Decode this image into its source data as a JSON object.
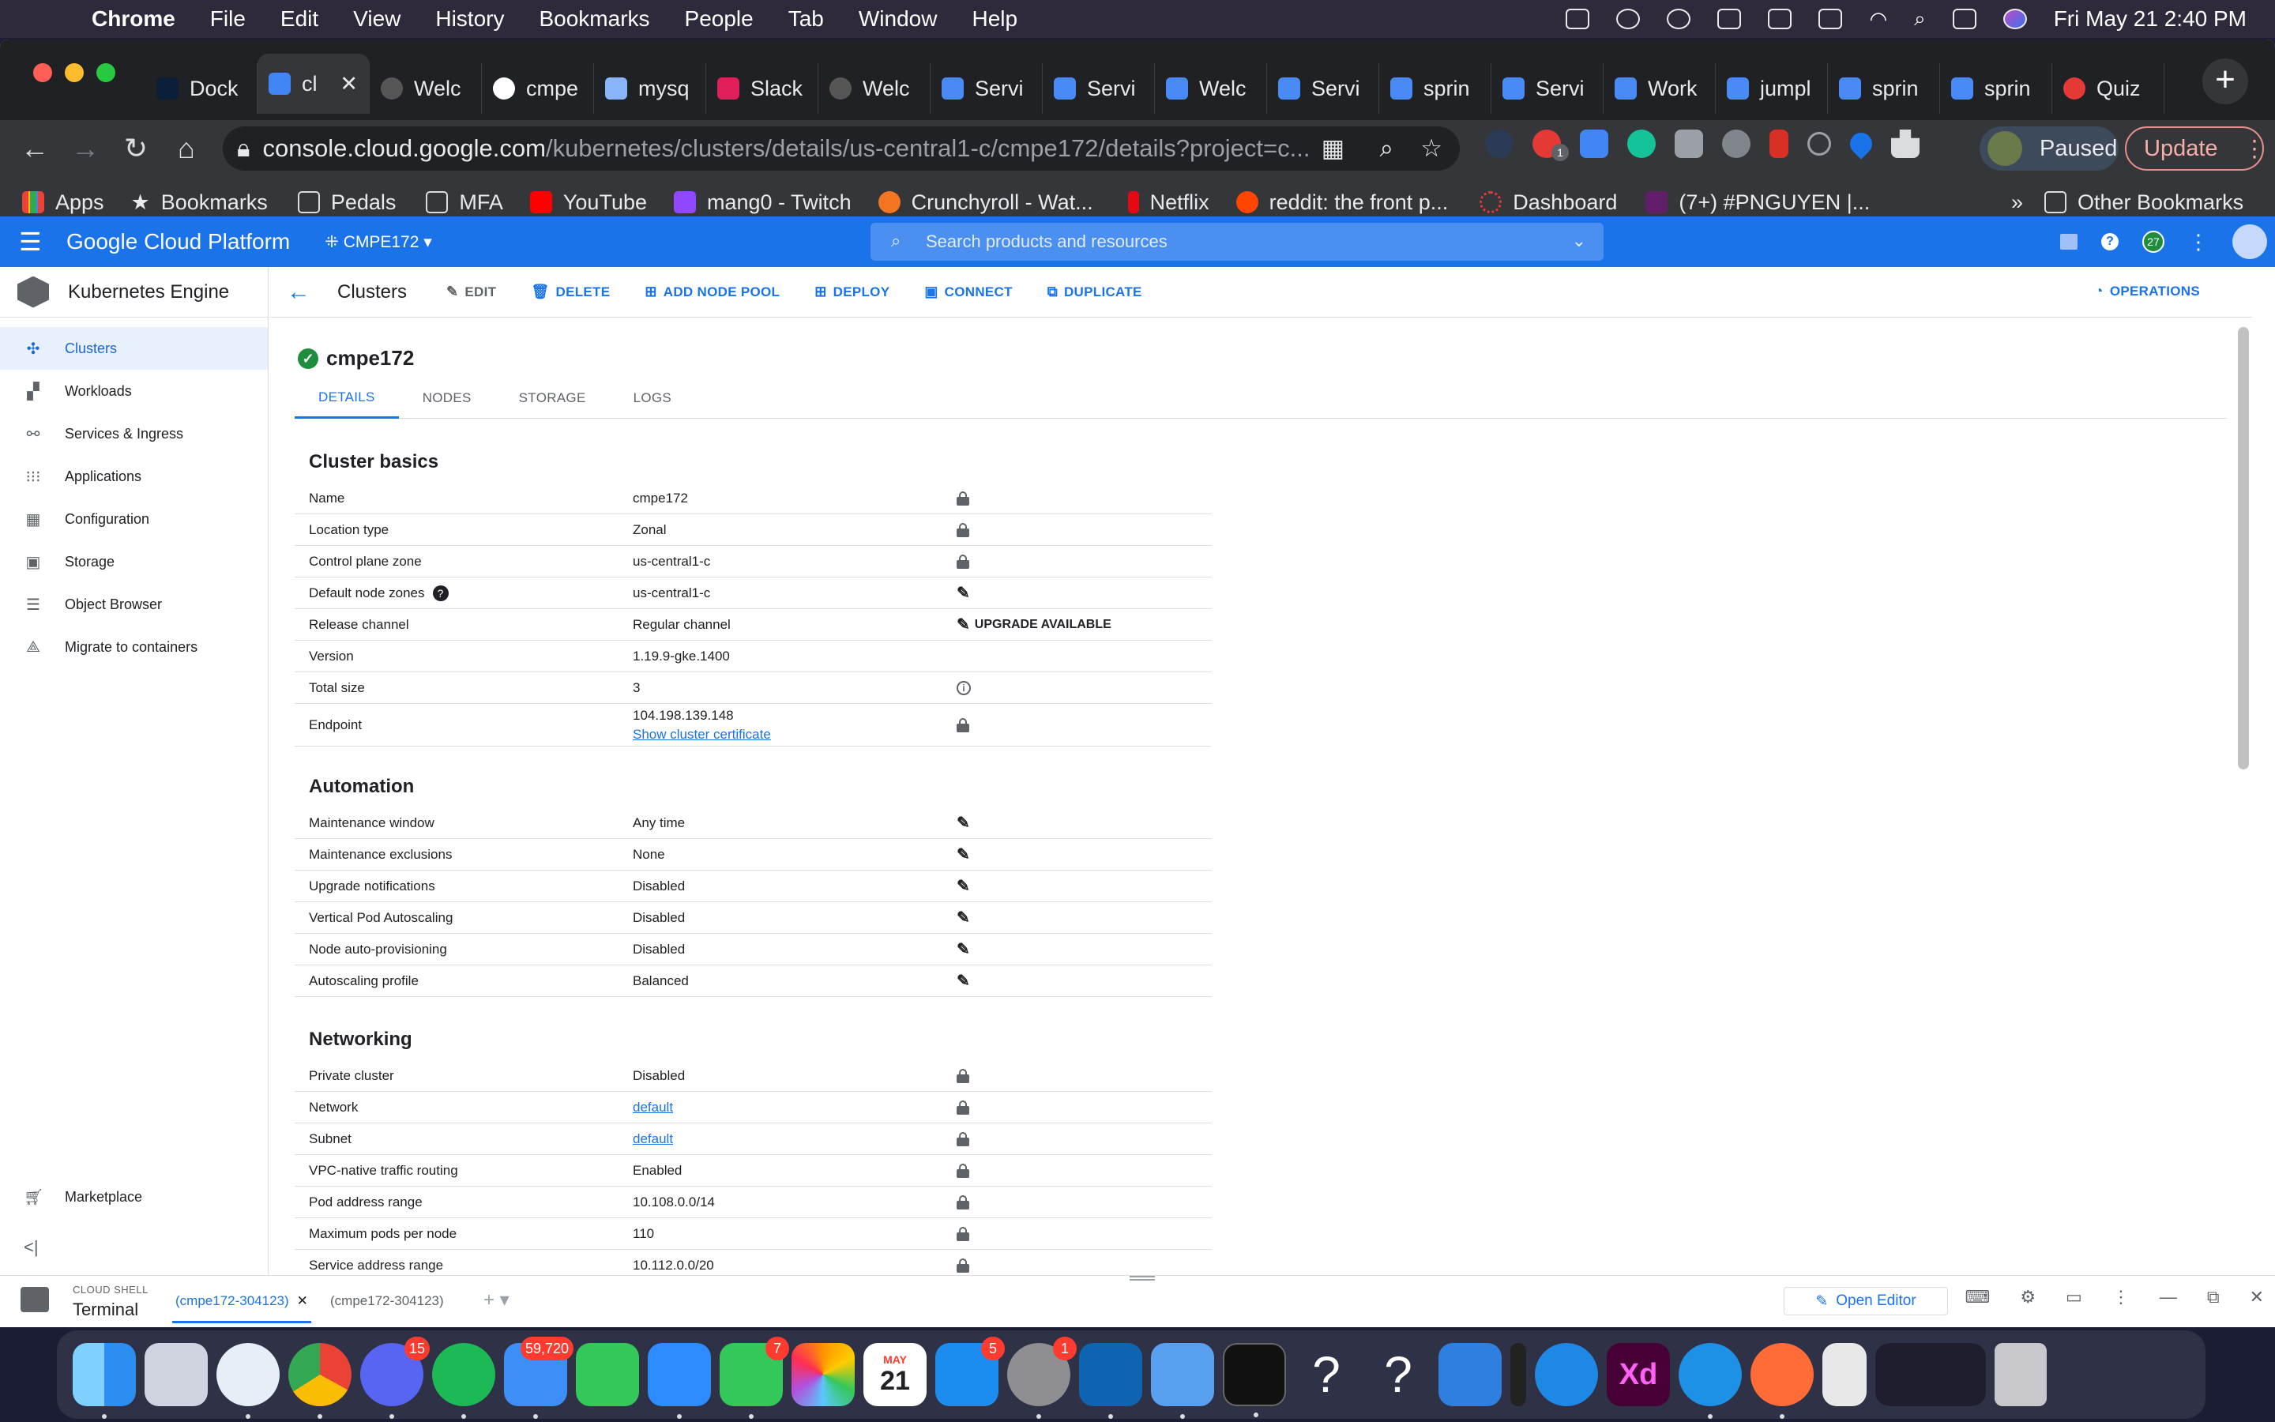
{
  "menubar": {
    "app": "Chrome",
    "items": [
      "File",
      "Edit",
      "View",
      "History",
      "Bookmarks",
      "People",
      "Tab",
      "Window",
      "Help"
    ],
    "datetime": "Fri May 21  2:40 PM"
  },
  "browser": {
    "tabs": [
      "Dock",
      "cl",
      "Welc",
      "cmpe",
      "mysq",
      "Slack",
      "Welc",
      "Servi",
      "Servi",
      "Welc",
      "Servi",
      "sprin",
      "Servi",
      "Work",
      "jumpl",
      "sprin",
      "sprin",
      "Quiz"
    ],
    "url_host": "console.cloud.google.com",
    "url_path": "/kubernetes/clusters/details/us-central1-c/cmpe172/details?project=c...",
    "profile_label": "Paused",
    "update_label": "Update",
    "bookmarks": [
      "Apps",
      "Bookmarks",
      "Pedals",
      "MFA",
      "YouTube",
      "mang0 - Twitch",
      "Crunchyroll - Wat...",
      "Netflix",
      "reddit: the front p...",
      "Dashboard",
      "(7+) #PNGUYEN |..."
    ],
    "more_bookmarks": "»",
    "other_bookmarks": "Other Bookmarks",
    "extension_badge": "1"
  },
  "gcp": {
    "brand": "Google Cloud Platform",
    "project": "CMPE172",
    "search_placeholder": "Search products and resources",
    "notif_count": "27"
  },
  "sidebar": {
    "product": "Kubernetes Engine",
    "items": [
      "Clusters",
      "Workloads",
      "Services & Ingress",
      "Applications",
      "Configuration",
      "Storage",
      "Object Browser",
      "Migrate to containers"
    ],
    "marketplace": "Marketplace"
  },
  "actions": {
    "page_title": "Clusters",
    "edit": "EDIT",
    "delete": "DELETE",
    "add_node_pool": "ADD NODE POOL",
    "deploy": "DEPLOY",
    "connect": "CONNECT",
    "duplicate": "DUPLICATE",
    "operations": "OPERATIONS"
  },
  "cluster": {
    "name": "cmpe172",
    "tabs": [
      "DETAILS",
      "NODES",
      "STORAGE",
      "LOGS"
    ]
  },
  "basics": {
    "title": "Cluster basics",
    "rows": [
      {
        "label": "Name",
        "value": "cmpe172"
      },
      {
        "label": "Location type",
        "value": "Zonal"
      },
      {
        "label": "Control plane zone",
        "value": "us-central1-c"
      },
      {
        "label": "Default node zones",
        "value": "us-central1-c"
      },
      {
        "label": "Release channel",
        "value": "Regular channel",
        "extra": "UPGRADE AVAILABLE"
      },
      {
        "label": "Version",
        "value": "1.19.9-gke.1400"
      },
      {
        "label": "Total size",
        "value": "3"
      },
      {
        "label": "Endpoint",
        "value": "104.198.139.148",
        "link": "Show cluster certificate"
      }
    ]
  },
  "automation": {
    "title": "Automation",
    "rows": [
      {
        "label": "Maintenance window",
        "value": "Any time"
      },
      {
        "label": "Maintenance exclusions",
        "value": "None"
      },
      {
        "label": "Upgrade notifications",
        "value": "Disabled"
      },
      {
        "label": "Vertical Pod Autoscaling",
        "value": "Disabled"
      },
      {
        "label": "Node auto-provisioning",
        "value": "Disabled"
      },
      {
        "label": "Autoscaling profile",
        "value": "Balanced"
      }
    ]
  },
  "networking": {
    "title": "Networking",
    "rows": [
      {
        "label": "Private cluster",
        "value": "Disabled"
      },
      {
        "label": "Network",
        "value": "default"
      },
      {
        "label": "Subnet",
        "value": "default"
      },
      {
        "label": "VPC-native traffic routing",
        "value": "Enabled"
      },
      {
        "label": "Pod address range",
        "value": "10.108.0.0/14"
      },
      {
        "label": "Maximum pods per node",
        "value": "110"
      },
      {
        "label": "Service address range",
        "value": "10.112.0.0/20"
      }
    ]
  },
  "shell": {
    "section_label": "CLOUD SHELL",
    "title": "Terminal",
    "tab1": "(cmpe172-304123)",
    "tab2": "(cmpe172-304123)",
    "open_editor": "Open Editor"
  },
  "dock": {
    "badges": {
      "discord": "15",
      "mail": "59,720",
      "messages": "7",
      "appstore": "5",
      "settings": "1"
    },
    "calendar_month": "MAY",
    "calendar_day": "21"
  }
}
